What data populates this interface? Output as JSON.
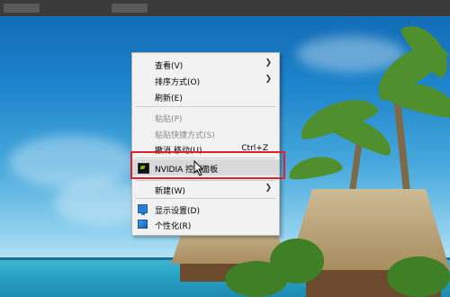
{
  "context_menu": {
    "items": [
      {
        "label": "查看(V)",
        "submenu": true,
        "disabled": false
      },
      {
        "label": "排序方式(O)",
        "submenu": true,
        "disabled": false
      },
      {
        "label": "刷新(E)",
        "submenu": false,
        "disabled": false
      },
      {
        "label": "粘贴(P)",
        "submenu": false,
        "disabled": true
      },
      {
        "label": "粘贴快捷方式(S)",
        "submenu": false,
        "disabled": true
      },
      {
        "label": "撤消 移动(U)",
        "shortcut": "Ctrl+Z",
        "submenu": false,
        "disabled": false
      },
      {
        "label": "NVIDIA 控制面板",
        "icon": "nvidia-icon",
        "highlighted": true
      },
      {
        "label": "新建(W)",
        "submenu": true,
        "disabled": false
      },
      {
        "label": "显示设置(D)",
        "icon": "display-settings-icon"
      },
      {
        "label": "个性化(R)",
        "icon": "personalize-icon"
      }
    ],
    "highlight_box_color": "#e0202a"
  },
  "icons": {
    "submenu_arrow": "chevron-right-icon",
    "cursor": "mouse-pointer-icon"
  }
}
